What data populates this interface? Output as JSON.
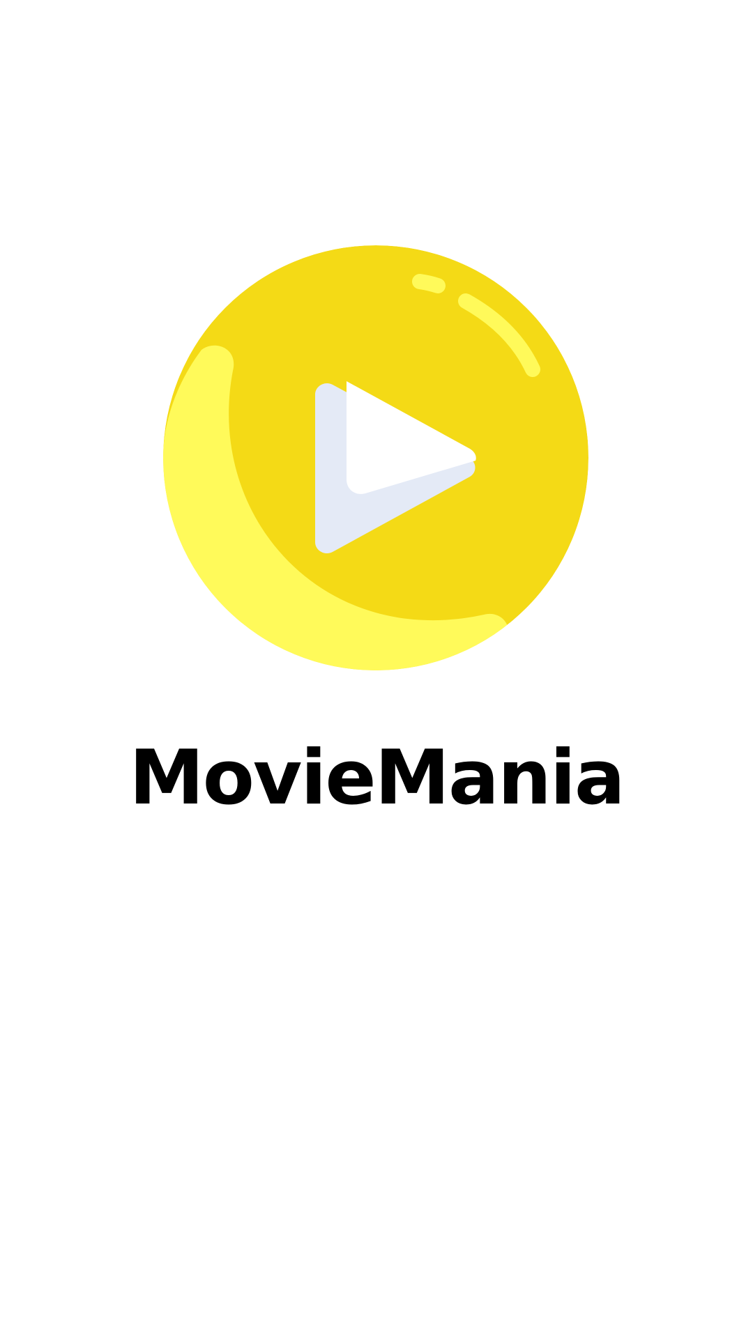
{
  "splash": {
    "app_name": "MovieMania",
    "logo_icon": "play-button-icon",
    "colors": {
      "background": "#ffffff",
      "logo_main": "#f4da16",
      "logo_highlight": "#fffa5a",
      "play_front": "#ffffff",
      "play_shadow": "#e4eaf6",
      "title_text": "#000000"
    }
  }
}
